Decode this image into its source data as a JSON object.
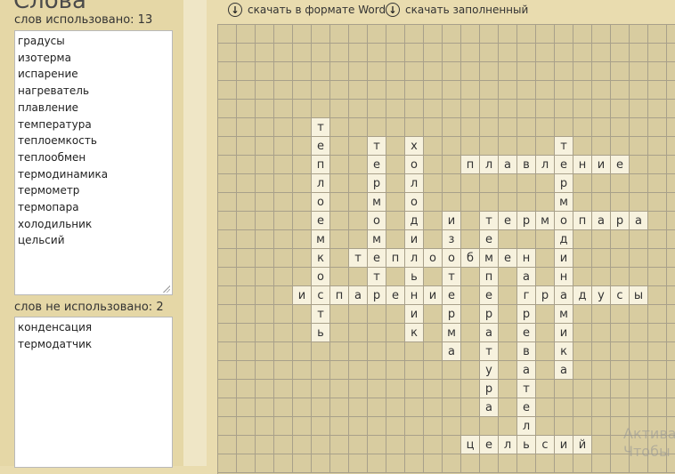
{
  "panel": {
    "title": "Слова",
    "used_label": "слов использовано: 13",
    "used_words": [
      "градусы",
      "изотерма",
      "испарение",
      "нагреватель",
      "плавление",
      "температура",
      "теплоемкость",
      "теплообмен",
      "термодинамика",
      "термометр",
      "термопара",
      "холодильник",
      "цельсий"
    ],
    "unused_label": "слов не использовано: 2",
    "unused_words": [
      "конденсация",
      "термодатчик"
    ]
  },
  "toolbar": {
    "download_word": "скачать в формате Word",
    "download_filled": "скачать заполненный",
    "icon": "download-arrow-icon"
  },
  "watermark": {
    "line1": "Актива",
    "line2": "Чтобы а"
  },
  "crossword": {
    "columns": 25,
    "rows": 24,
    "words": [
      {
        "word": "теплоемкость",
        "row": 5,
        "col": 5,
        "dir": "down"
      },
      {
        "word": "термометр",
        "row": 6,
        "col": 8,
        "dir": "down"
      },
      {
        "word": "холодильник",
        "row": 6,
        "col": 10,
        "dir": "down"
      },
      {
        "word": "термодинамика",
        "row": 6,
        "col": 18,
        "dir": "down"
      },
      {
        "word": "плавление",
        "row": 7,
        "col": 13,
        "dir": "across"
      },
      {
        "word": "термопара",
        "row": 10,
        "col": 14,
        "dir": "across"
      },
      {
        "word": "изотерма",
        "row": 10,
        "col": 12,
        "dir": "down"
      },
      {
        "word": "температура",
        "row": 10,
        "col": 14,
        "dir": "down"
      },
      {
        "word": "теплообмен",
        "row": 12,
        "col": 7,
        "dir": "across"
      },
      {
        "word": "нагреватель",
        "row": 12,
        "col": 16,
        "dir": "down"
      },
      {
        "word": "испарение",
        "row": 14,
        "col": 4,
        "dir": "across"
      },
      {
        "word": "градусы",
        "row": 14,
        "col": 16,
        "dir": "across"
      },
      {
        "word": "цельсий",
        "row": 22,
        "col": 13,
        "dir": "across"
      }
    ]
  }
}
